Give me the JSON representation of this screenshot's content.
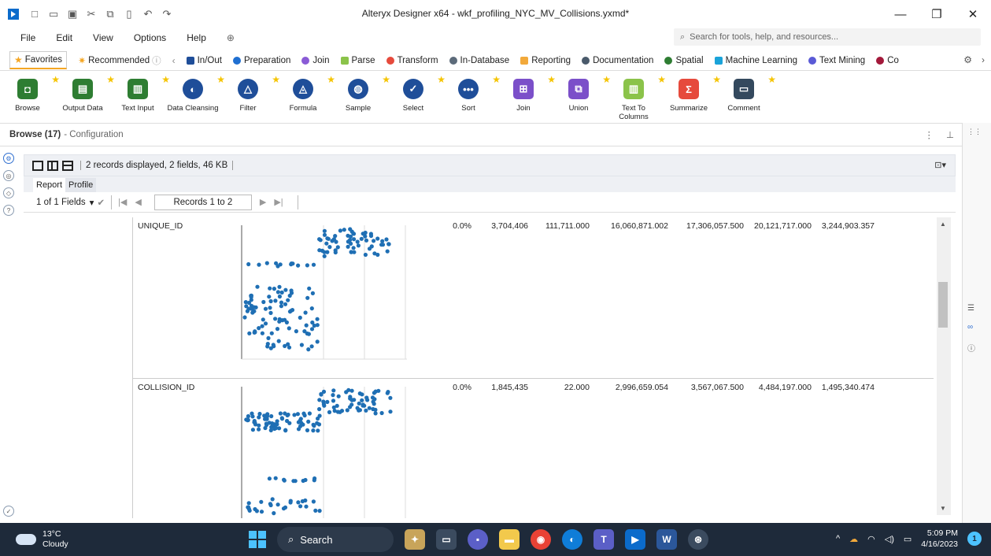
{
  "window": {
    "title": "Alteryx Designer x64 - wkf_profiling_NYC_MV_Collisions.yxmd*",
    "minimize": "—",
    "restore": "❐",
    "close": "✕"
  },
  "menu": {
    "items": [
      "File",
      "Edit",
      "View",
      "Options",
      "Help"
    ],
    "search_placeholder": "Search for tools, help, and resources..."
  },
  "categories": {
    "favorites": "Favorites",
    "recommended": "Recommended",
    "items": [
      {
        "label": "In/Out",
        "color": "#1f4e99"
      },
      {
        "label": "Preparation",
        "color": "#1f6fd1"
      },
      {
        "label": "Join",
        "color": "#8a5bd6"
      },
      {
        "label": "Parse",
        "color": "#8bc34a"
      },
      {
        "label": "Transform",
        "color": "#e64a3c"
      },
      {
        "label": "In-Database",
        "color": "#5c6b7a"
      },
      {
        "label": "Reporting",
        "color": "#f2a93b"
      },
      {
        "label": "Documentation",
        "color": "#4a5a6b"
      },
      {
        "label": "Spatial",
        "color": "#2e7d32"
      },
      {
        "label": "Machine Learning",
        "color": "#1aa3d9"
      },
      {
        "label": "Text Mining",
        "color": "#5a5ad6"
      },
      {
        "label": "Co",
        "color": "#a3193a"
      }
    ]
  },
  "tools": [
    {
      "label": "Browse",
      "color": "#2e7d32",
      "glyph": "◘"
    },
    {
      "label": "Output Data",
      "color": "#2e7d32",
      "glyph": "▤"
    },
    {
      "label": "Text Input",
      "color": "#2e7d32",
      "glyph": "▥"
    },
    {
      "label": "Data Cleansing",
      "color": "#1f4e99",
      "glyph": "◐"
    },
    {
      "label": "Filter",
      "color": "#1f4e99",
      "glyph": "△"
    },
    {
      "label": "Formula",
      "color": "#1f4e99",
      "glyph": "◬"
    },
    {
      "label": "Sample",
      "color": "#1f4e99",
      "glyph": "◍"
    },
    {
      "label": "Select",
      "color": "#1f4e99",
      "glyph": "✓"
    },
    {
      "label": "Sort",
      "color": "#1f4e99",
      "glyph": "•••"
    },
    {
      "label": "Join",
      "color": "#7b4fc9",
      "glyph": "⊞"
    },
    {
      "label": "Union",
      "color": "#7b4fc9",
      "glyph": "⧉"
    },
    {
      "label": "Text To Columns",
      "color": "#8bc34a",
      "glyph": "▥"
    },
    {
      "label": "Summarize",
      "color": "#e64a3c",
      "glyph": "Σ"
    },
    {
      "label": "Comment",
      "color": "#34495e",
      "glyph": "▭"
    }
  ],
  "config": {
    "title": "Browse (17)",
    "subtitle": "- Configuration"
  },
  "browse": {
    "record_info": "2 records displayed, 2 fields, 46 KB",
    "tabs": [
      "Report",
      "Profile"
    ],
    "fields_selector": "1 of 1 Fields",
    "records_label": "Records 1 to 2"
  },
  "rows": [
    {
      "field": "UNIQUE_ID",
      "pct_null": "0.0%",
      "unique": "3,704,406",
      "min": "111,711.000",
      "mean": "16,060,871.002",
      "median": "17,306,057.500",
      "max": "20,121,717.000",
      "std": "3,244,903.357"
    },
    {
      "field": "COLLISION_ID",
      "pct_null": "0.0%",
      "unique": "1,845,435",
      "min": "22.000",
      "mean": "2,996,659.054",
      "median": "3,567,067.500",
      "max": "4,484,197.000",
      "std": "1,495,340.474"
    }
  ],
  "taskbar": {
    "temp": "13°C",
    "condition": "Cloudy",
    "search": "Search",
    "time": "5:09 PM",
    "date": "4/16/2023",
    "notif": "1"
  }
}
